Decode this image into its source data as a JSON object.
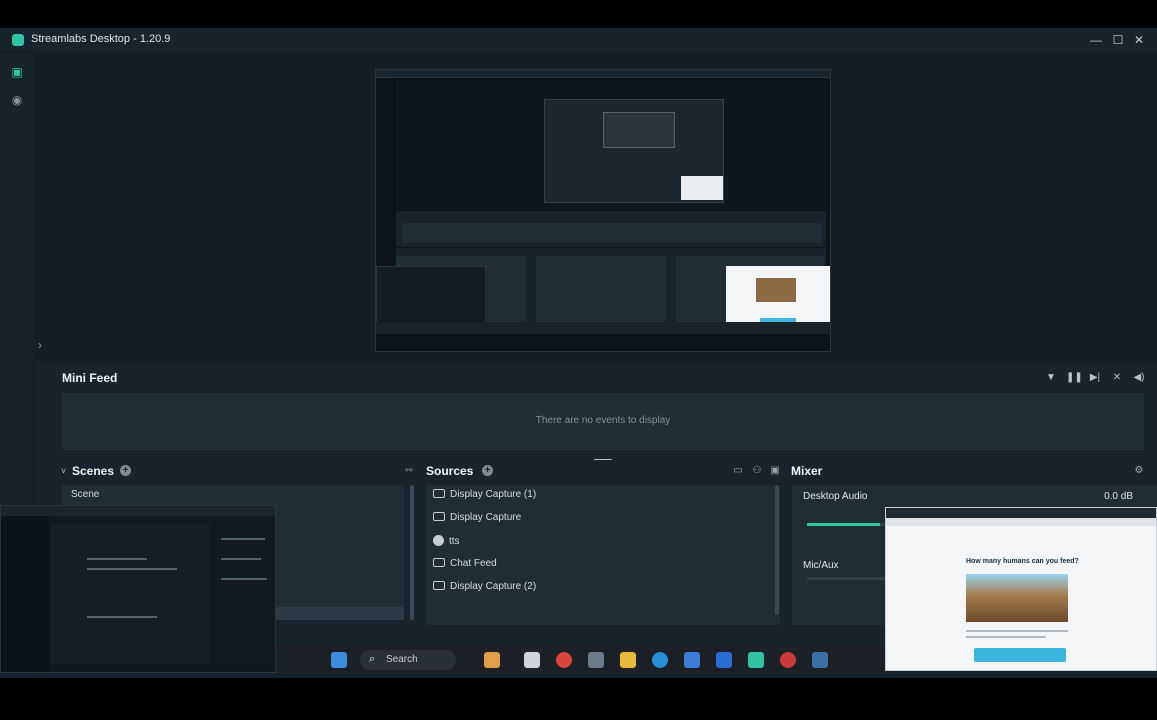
{
  "window": {
    "title": "Streamlabs Desktop - 1.20.9",
    "controls": {
      "minimize": "—",
      "maximize": "☐",
      "close": "✕"
    }
  },
  "minifeed": {
    "title": "Mini Feed",
    "empty_text": "There are no events to display"
  },
  "scenes": {
    "title": "Scenes",
    "items": [
      "Scene"
    ]
  },
  "sources": {
    "title": "Sources",
    "items": [
      {
        "label": "Display Capture (1)",
        "icon": "monitor-icon"
      },
      {
        "label": "Display Capture",
        "icon": "monitor-icon"
      },
      {
        "label": "tts",
        "icon": "audio-source-icon"
      },
      {
        "label": "Chat Feed",
        "icon": "monitor-icon"
      },
      {
        "label": "Display Capture (2)",
        "icon": "monitor-icon"
      }
    ]
  },
  "mixer": {
    "title": "Mixer",
    "channels": [
      {
        "name": "Desktop Audio",
        "db": "0.0 dB",
        "level": 0.22
      },
      {
        "name": "Mic/Aux",
        "db": "",
        "level": 0.0
      }
    ]
  },
  "browser_overlay": {
    "headline": "How many humans can you feed?"
  },
  "taskbar": {
    "search_label": "Search"
  },
  "colors": {
    "accent": "#31c3a2",
    "background": "#17242d",
    "panel": "#1f2d36"
  }
}
